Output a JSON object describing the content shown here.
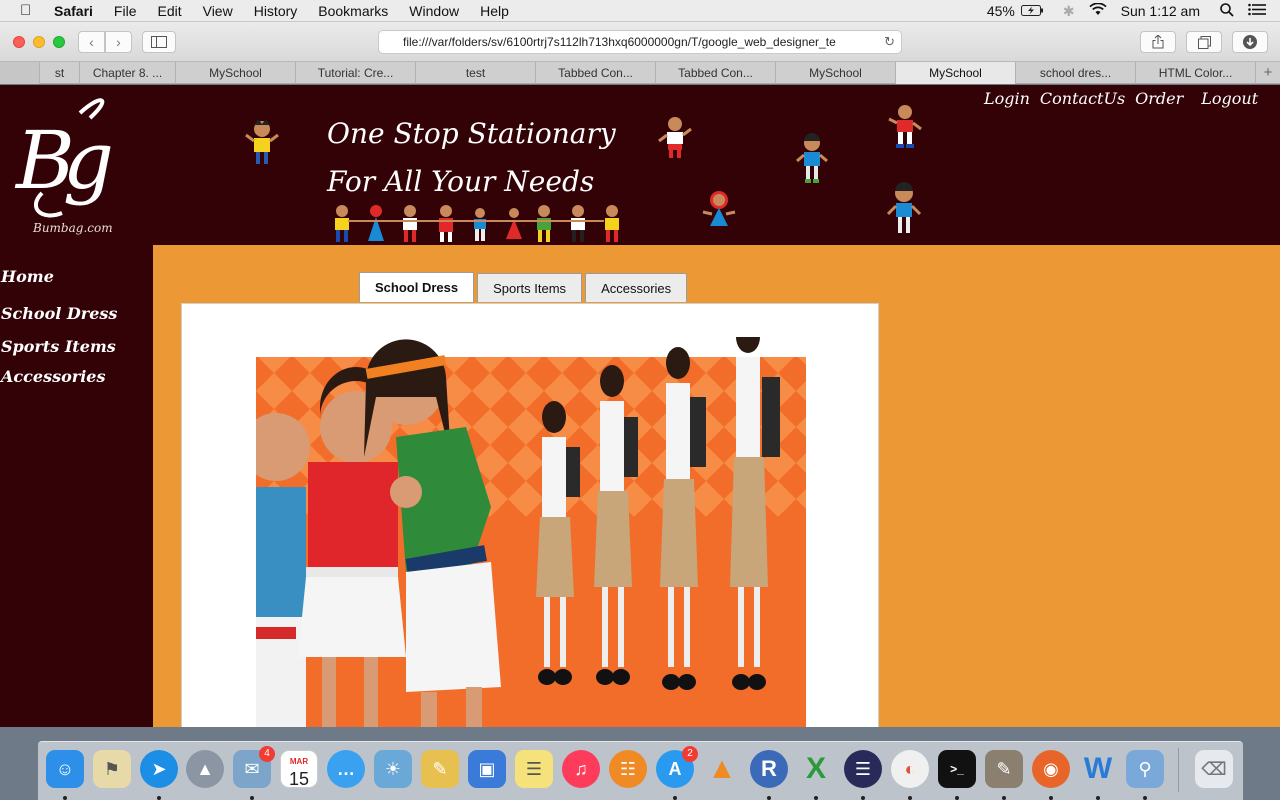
{
  "menubar": {
    "app": "Safari",
    "items": [
      "File",
      "Edit",
      "View",
      "History",
      "Bookmarks",
      "Window",
      "Help"
    ],
    "battery": "45%",
    "clock": "Sun 1:12 am"
  },
  "browser": {
    "url": "file:///var/folders/sv/6100rtrj7s112lh713hxq6000000gn/T/google_web_designer_te",
    "tabs": [
      {
        "label": "st",
        "active": false
      },
      {
        "label": "Chapter 8. ...",
        "active": false
      },
      {
        "label": "MySchool",
        "active": false
      },
      {
        "label": "Tutorial: Cre...",
        "active": false
      },
      {
        "label": "test",
        "active": false
      },
      {
        "label": "Tabbed Con...",
        "active": false
      },
      {
        "label": "Tabbed Con...",
        "active": false
      },
      {
        "label": "MySchool",
        "active": false
      },
      {
        "label": "MySchool",
        "active": true
      },
      {
        "label": "school dres...",
        "active": false
      },
      {
        "label": "HTML Color...",
        "active": false
      }
    ],
    "new_tab": "+"
  },
  "site": {
    "logo_letters": "Bg",
    "brand": "Bumbag.com",
    "tagline_1": "One Stop Stationary",
    "tagline_2": "For All Your Needs",
    "top_nav": {
      "login": "Login",
      "contact": "ContactUs",
      "order": "Order",
      "logout": "Logout"
    },
    "side_nav": {
      "home": "Home",
      "school_dress": "School Dress",
      "sports_items": "Sports Items",
      "accessories": "Accessories"
    },
    "tabs": {
      "school_dress": "School Dress",
      "sports_items": "Sports Items",
      "accessories": "Accessories"
    },
    "active_tab": "School Dress"
  },
  "dock": {
    "badges": {
      "mail": "4",
      "appstore": "2"
    },
    "calendar": {
      "month": "MAR",
      "day": "15"
    }
  },
  "colors": {
    "header_bg": "#330206",
    "content_bg": "#ec9835",
    "photo_bg": "#f36d2a"
  }
}
